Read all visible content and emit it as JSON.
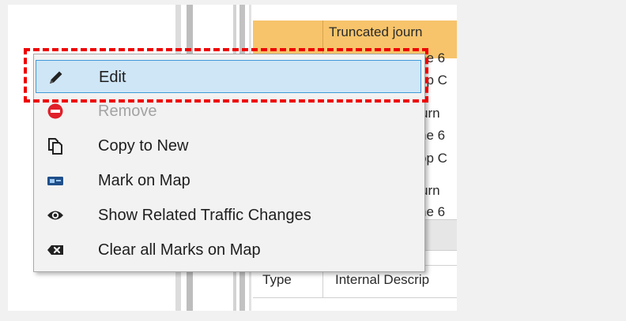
{
  "background_grid": {
    "row1_col2_line1": "Truncated journ",
    "row1_col2_line2": "ne 6",
    "row1_col2_line3": "op C",
    "row2_line1": "urn",
    "row2_line2": "ne 6",
    "row2_line3": "op C",
    "row3_line1": "urn",
    "row3_line2": "ne 6",
    "type_header": "Type",
    "internal_description_header": "Internal Descrip"
  },
  "context_menu": {
    "items": [
      {
        "label": "Edit",
        "icon": "pencil-icon",
        "state": "highlighted"
      },
      {
        "label": "Remove",
        "icon": "remove-icon",
        "state": "disabled"
      },
      {
        "label": "Copy to New",
        "icon": "copy-icon",
        "state": "normal"
      },
      {
        "label": "Mark on Map",
        "icon": "map-marker-icon",
        "state": "normal"
      },
      {
        "label": "Show Related Traffic Changes",
        "icon": "eye-icon",
        "state": "normal"
      },
      {
        "label": "Clear all Marks on Map",
        "icon": "clear-marks-icon",
        "state": "normal"
      }
    ]
  },
  "colors": {
    "highlight_fill": "#cfe6f6",
    "highlight_border": "#3f99d8",
    "row_highlight": "#f7c46b",
    "remove_icon": "#e0202a",
    "annotation": "#ee0000"
  }
}
